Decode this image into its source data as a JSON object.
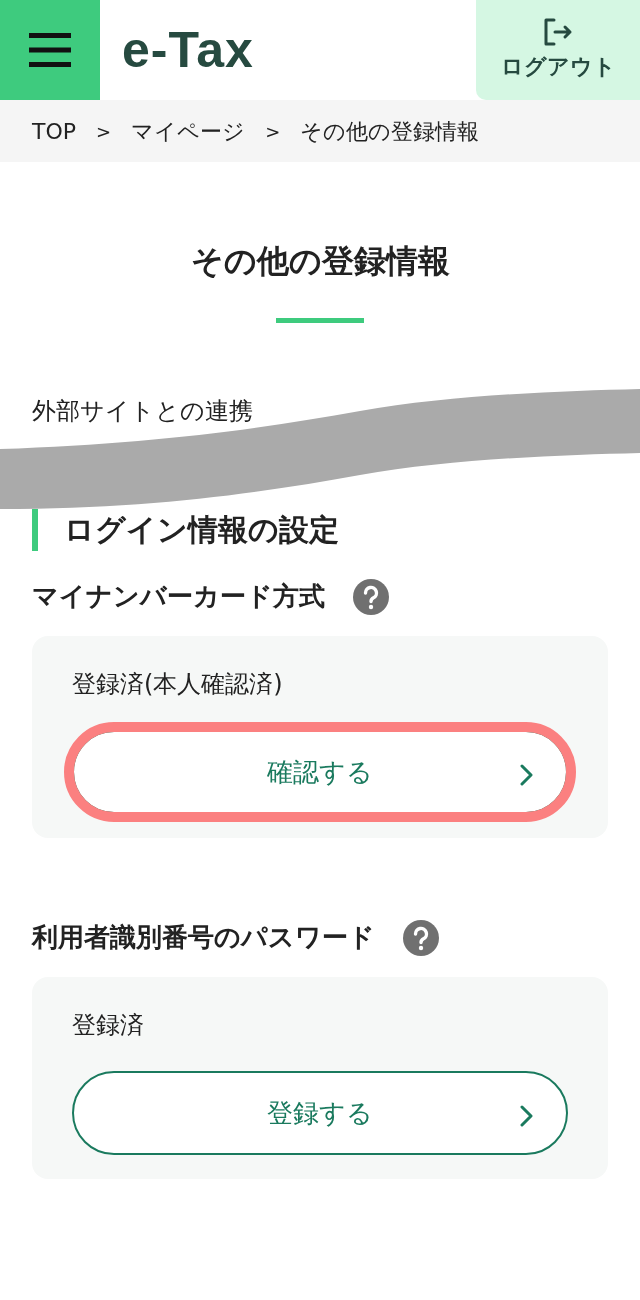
{
  "header": {
    "logo": "e-Tax",
    "logout_label": "ログアウト"
  },
  "breadcrumb": [
    {
      "label": "TOP",
      "kind": "link"
    },
    {
      "label": ">",
      "kind": "separator"
    },
    {
      "label": "マイページ",
      "kind": "link"
    },
    {
      "label": ">",
      "kind": "separator"
    },
    {
      "label": "その他の登録情報",
      "kind": "current"
    }
  ],
  "page_title": "その他の登録情報",
  "external_link_section": "外部サイトとの連携",
  "section_heading": "ログイン情報の設定",
  "items": [
    {
      "title": "マイナンバーカード方式",
      "status": "登録済(本人確認済)",
      "button": "確認する",
      "highlighted": true
    },
    {
      "title": "利用者識別番号のパスワード",
      "status": "登録済",
      "button": "登録する",
      "highlighted": false
    }
  ]
}
